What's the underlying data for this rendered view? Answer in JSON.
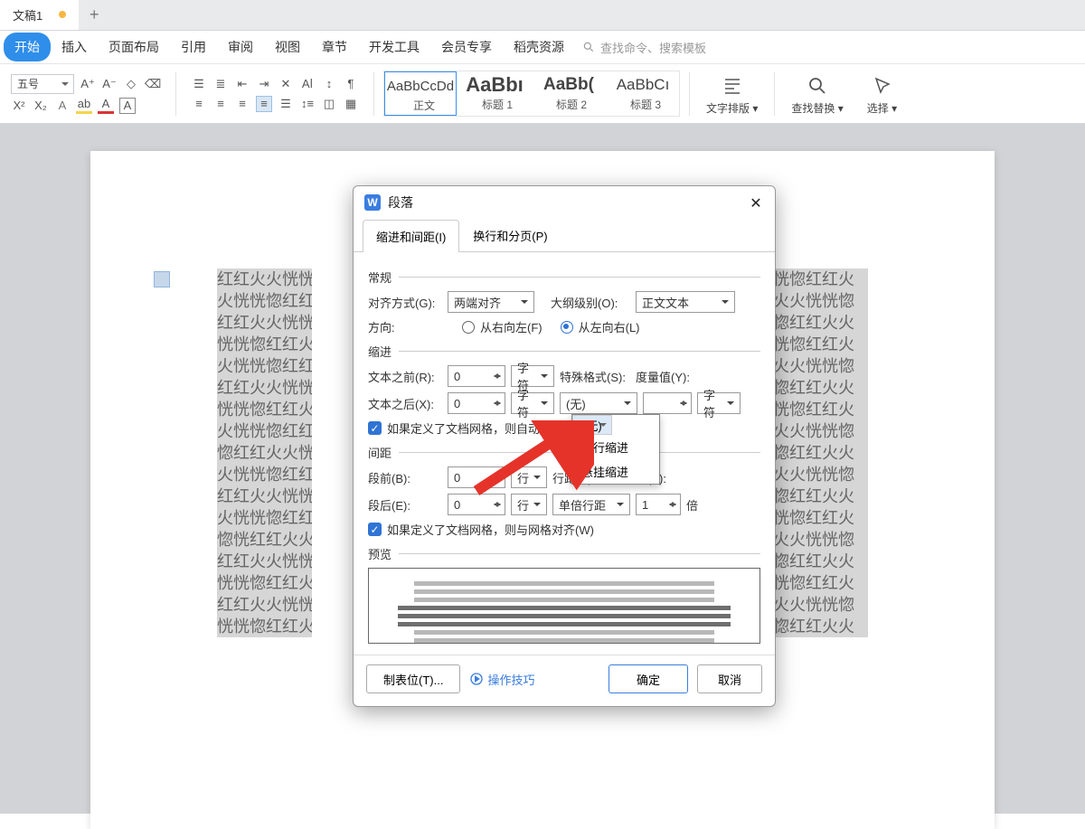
{
  "tab": {
    "title": "文稿1",
    "add_tip": "+"
  },
  "menu": {
    "items": [
      "开始",
      "插入",
      "页面布局",
      "引用",
      "审阅",
      "视图",
      "章节",
      "开发工具",
      "会员专享",
      "稻壳资源"
    ],
    "active": 0,
    "search_placeholder": "查找命令、搜索模板"
  },
  "ribbon": {
    "font_size": "五号",
    "styles": [
      {
        "sample": "AaBbCcDd",
        "label": "正文",
        "selected": true
      },
      {
        "sample": "AaBbı",
        "label": "标题 1",
        "bold": true
      },
      {
        "sample": "AaBb(",
        "label": "标题 2",
        "bold": true
      },
      {
        "sample": "AaBbCı",
        "label": "标题 3",
        "bold": false
      }
    ],
    "tool_typeset": "文字排版",
    "tool_find": "查找替换",
    "tool_select": "选择"
  },
  "doc_line": "红红火火恍恍惚惚红红火火恍恍惚惚红红火火恍恍惚惚红红火火恍恍惚惚",
  "left_lines": [
    "红红火火恍恍惚",
    "火恍恍惚红红火",
    "红红火火恍恍惚",
    "恍恍惚红红火恍",
    "火恍恍惚红红火",
    "红红火火恍恍惚",
    "恍恍惚红红火恍",
    "火恍恍惚红红火",
    "惚红红火火恍恍",
    "火恍恍惚红红火",
    "红红火火恍恍惚",
    "火恍恍惚红红火",
    "惚恍红红火火恍",
    "红红火火恍恍惚",
    "恍恍惚红红火恍",
    "红红火火恍恍惚",
    "恍恍惚红红火恍"
  ],
  "right_lines": [
    "恍惚红红火",
    "火火恍恍惚",
    "惚红红火火",
    "恍惚红红火",
    "火火恍恍惚",
    "惚红红火火",
    "恍惚红红火",
    "火火恍恍惚",
    "惚红红火火",
    "火火恍恍惚",
    "惚红红火火",
    "恍惚红红火",
    "火火恍恍惚",
    "惚红红火火",
    "恍惚红红火",
    "火火恍恍惚",
    "惚红红火火"
  ],
  "dialog": {
    "title": "段落",
    "tabs": [
      "缩进和间距(I)",
      "换行和分页(P)"
    ],
    "active_tab": 0,
    "sec_general": "常规",
    "align_label": "对齐方式(G):",
    "align_value": "两端对齐",
    "outline_label": "大纲级别(O):",
    "outline_value": "正文文本",
    "direction_label": "方向:",
    "dir_rtl": "从右向左(F)",
    "dir_ltr": "从左向右(L)",
    "sec_indent": "缩进",
    "before_text_label": "文本之前(R):",
    "before_text_val": "0",
    "after_text_label": "文本之后(X):",
    "after_text_val": "0",
    "unit_char": "字符",
    "special_label": "特殊格式(S):",
    "special_value": "(无)",
    "measure_label": "度量值(Y):",
    "measure_val": "",
    "grid_check1": "如果定义了文档网格，则自动调整右缩进(D)",
    "sec_spacing": "间距",
    "before_para_label": "段前(B):",
    "before_para_val": "0",
    "unit_line": "行",
    "after_para_label": "段后(E):",
    "after_para_val": "0",
    "line_spacing_label": "行距(N):",
    "line_spacing_value": "单倍行距",
    "set_value_label": "设置值(A):",
    "set_value_val": "1",
    "unit_times": "倍",
    "grid_check2": "如果定义了文档网格，则与网格对齐(W)",
    "sec_preview": "预览",
    "tabstop_btn": "制表位(T)...",
    "tips_link": "操作技巧",
    "ok": "确定",
    "cancel": "取消",
    "dropdown_options": [
      "(无)",
      "首行缩进",
      "悬挂缩进"
    ]
  }
}
